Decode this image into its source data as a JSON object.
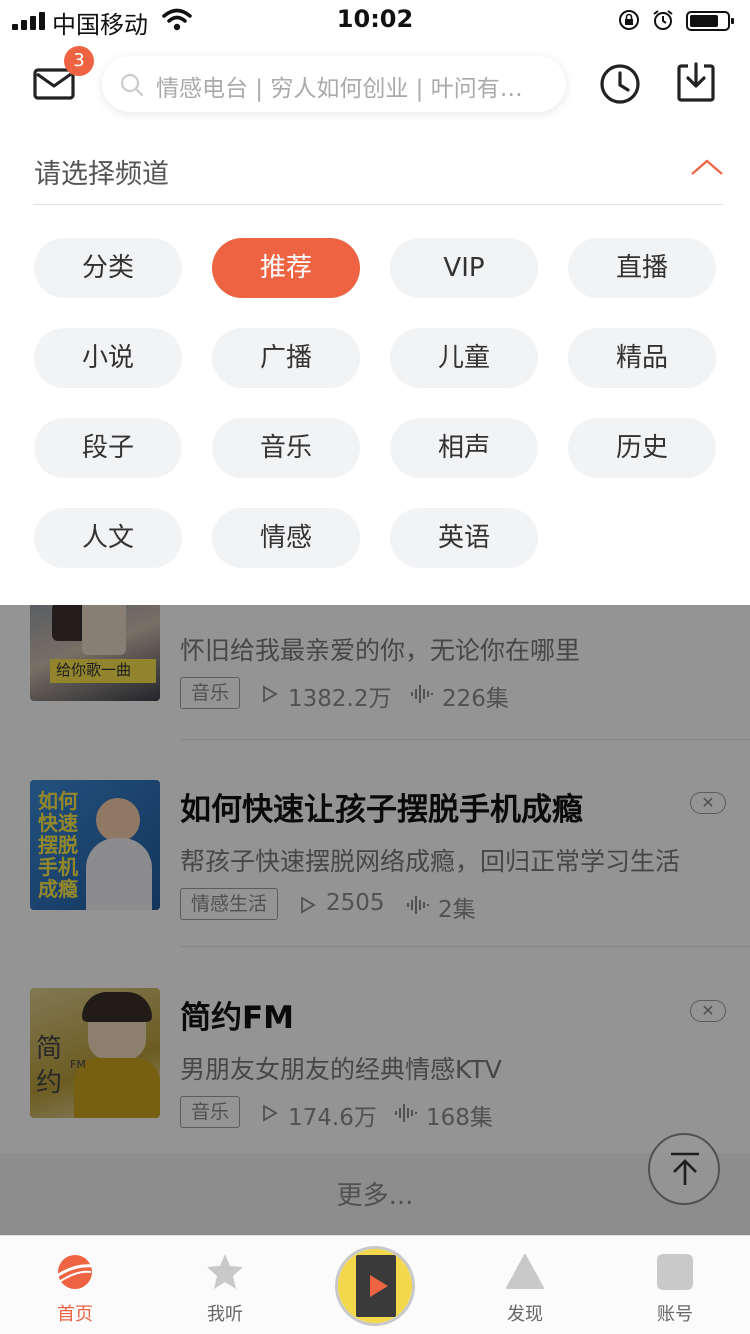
{
  "status_bar": {
    "carrier": "中国移动",
    "time": "10:02"
  },
  "header": {
    "mail_badge_count": "3",
    "search_placeholder": "情感电台 | 穷人如何创业 | 叶问有…"
  },
  "channel_panel": {
    "title": "请选择频道",
    "channels": [
      {
        "label": "分类",
        "active": false
      },
      {
        "label": "推荐",
        "active": true
      },
      {
        "label": "VIP",
        "active": false
      },
      {
        "label": "直播",
        "active": false
      },
      {
        "label": "小说",
        "active": false
      },
      {
        "label": "广播",
        "active": false
      },
      {
        "label": "儿童",
        "active": false
      },
      {
        "label": "精品",
        "active": false
      },
      {
        "label": "段子",
        "active": false
      },
      {
        "label": "音乐",
        "active": false
      },
      {
        "label": "相声",
        "active": false
      },
      {
        "label": "历史",
        "active": false
      },
      {
        "label": "人文",
        "active": false
      },
      {
        "label": "情感",
        "active": false
      },
      {
        "label": "英语",
        "active": false
      }
    ]
  },
  "feed": {
    "items": [
      {
        "cover_text": "给你歌一曲",
        "description": "怀旧给我最亲爱的你，无论你在哪里",
        "tag": "音乐",
        "plays": "1382.2万",
        "episodes": "226集"
      },
      {
        "cover_text": "如何快速摆脱手机成瘾",
        "title": "如何快速让孩子摆脱手机成瘾",
        "description": "帮孩子快速摆脱网络成瘾，回归正常学习生活",
        "tag": "情感生活",
        "plays": "2505",
        "episodes": "2集"
      },
      {
        "cover_text": "简约",
        "cover_sub": "FM",
        "title": "简约FM",
        "description": "男朋友女朋友的经典情感KTV",
        "tag": "音乐",
        "plays": "174.6万",
        "episodes": "168集"
      }
    ],
    "more_label": "更多..."
  },
  "tab_bar": {
    "tabs": [
      {
        "label": "首页",
        "icon": "planet-icon",
        "active": true
      },
      {
        "label": "我听",
        "icon": "star-icon",
        "active": false
      },
      {
        "label": "发现",
        "icon": "triangle-icon",
        "active": false
      },
      {
        "label": "账号",
        "icon": "square-icon",
        "active": false
      }
    ]
  },
  "colors": {
    "accent": "#ee6442",
    "chip_bg": "#f2f3f5"
  }
}
